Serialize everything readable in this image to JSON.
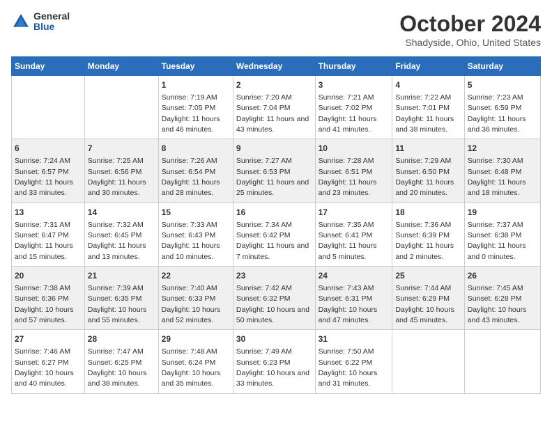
{
  "header": {
    "logo_general": "General",
    "logo_blue": "Blue",
    "main_title": "October 2024",
    "subtitle": "Shadyside, Ohio, United States"
  },
  "columns": [
    "Sunday",
    "Monday",
    "Tuesday",
    "Wednesday",
    "Thursday",
    "Friday",
    "Saturday"
  ],
  "weeks": [
    [
      {
        "day": "",
        "info": ""
      },
      {
        "day": "",
        "info": ""
      },
      {
        "day": "1",
        "info": "Sunrise: 7:19 AM\nSunset: 7:05 PM\nDaylight: 11 hours and 46 minutes."
      },
      {
        "day": "2",
        "info": "Sunrise: 7:20 AM\nSunset: 7:04 PM\nDaylight: 11 hours and 43 minutes."
      },
      {
        "day": "3",
        "info": "Sunrise: 7:21 AM\nSunset: 7:02 PM\nDaylight: 11 hours and 41 minutes."
      },
      {
        "day": "4",
        "info": "Sunrise: 7:22 AM\nSunset: 7:01 PM\nDaylight: 11 hours and 38 minutes."
      },
      {
        "day": "5",
        "info": "Sunrise: 7:23 AM\nSunset: 6:59 PM\nDaylight: 11 hours and 36 minutes."
      }
    ],
    [
      {
        "day": "6",
        "info": "Sunrise: 7:24 AM\nSunset: 6:57 PM\nDaylight: 11 hours and 33 minutes."
      },
      {
        "day": "7",
        "info": "Sunrise: 7:25 AM\nSunset: 6:56 PM\nDaylight: 11 hours and 30 minutes."
      },
      {
        "day": "8",
        "info": "Sunrise: 7:26 AM\nSunset: 6:54 PM\nDaylight: 11 hours and 28 minutes."
      },
      {
        "day": "9",
        "info": "Sunrise: 7:27 AM\nSunset: 6:53 PM\nDaylight: 11 hours and 25 minutes."
      },
      {
        "day": "10",
        "info": "Sunrise: 7:28 AM\nSunset: 6:51 PM\nDaylight: 11 hours and 23 minutes."
      },
      {
        "day": "11",
        "info": "Sunrise: 7:29 AM\nSunset: 6:50 PM\nDaylight: 11 hours and 20 minutes."
      },
      {
        "day": "12",
        "info": "Sunrise: 7:30 AM\nSunset: 6:48 PM\nDaylight: 11 hours and 18 minutes."
      }
    ],
    [
      {
        "day": "13",
        "info": "Sunrise: 7:31 AM\nSunset: 6:47 PM\nDaylight: 11 hours and 15 minutes."
      },
      {
        "day": "14",
        "info": "Sunrise: 7:32 AM\nSunset: 6:45 PM\nDaylight: 11 hours and 13 minutes."
      },
      {
        "day": "15",
        "info": "Sunrise: 7:33 AM\nSunset: 6:43 PM\nDaylight: 11 hours and 10 minutes."
      },
      {
        "day": "16",
        "info": "Sunrise: 7:34 AM\nSunset: 6:42 PM\nDaylight: 11 hours and 7 minutes."
      },
      {
        "day": "17",
        "info": "Sunrise: 7:35 AM\nSunset: 6:41 PM\nDaylight: 11 hours and 5 minutes."
      },
      {
        "day": "18",
        "info": "Sunrise: 7:36 AM\nSunset: 6:39 PM\nDaylight: 11 hours and 2 minutes."
      },
      {
        "day": "19",
        "info": "Sunrise: 7:37 AM\nSunset: 6:38 PM\nDaylight: 11 hours and 0 minutes."
      }
    ],
    [
      {
        "day": "20",
        "info": "Sunrise: 7:38 AM\nSunset: 6:36 PM\nDaylight: 10 hours and 57 minutes."
      },
      {
        "day": "21",
        "info": "Sunrise: 7:39 AM\nSunset: 6:35 PM\nDaylight: 10 hours and 55 minutes."
      },
      {
        "day": "22",
        "info": "Sunrise: 7:40 AM\nSunset: 6:33 PM\nDaylight: 10 hours and 52 minutes."
      },
      {
        "day": "23",
        "info": "Sunrise: 7:42 AM\nSunset: 6:32 PM\nDaylight: 10 hours and 50 minutes."
      },
      {
        "day": "24",
        "info": "Sunrise: 7:43 AM\nSunset: 6:31 PM\nDaylight: 10 hours and 47 minutes."
      },
      {
        "day": "25",
        "info": "Sunrise: 7:44 AM\nSunset: 6:29 PM\nDaylight: 10 hours and 45 minutes."
      },
      {
        "day": "26",
        "info": "Sunrise: 7:45 AM\nSunset: 6:28 PM\nDaylight: 10 hours and 43 minutes."
      }
    ],
    [
      {
        "day": "27",
        "info": "Sunrise: 7:46 AM\nSunset: 6:27 PM\nDaylight: 10 hours and 40 minutes."
      },
      {
        "day": "28",
        "info": "Sunrise: 7:47 AM\nSunset: 6:25 PM\nDaylight: 10 hours and 38 minutes."
      },
      {
        "day": "29",
        "info": "Sunrise: 7:48 AM\nSunset: 6:24 PM\nDaylight: 10 hours and 35 minutes."
      },
      {
        "day": "30",
        "info": "Sunrise: 7:49 AM\nSunset: 6:23 PM\nDaylight: 10 hours and 33 minutes."
      },
      {
        "day": "31",
        "info": "Sunrise: 7:50 AM\nSunset: 6:22 PM\nDaylight: 10 hours and 31 minutes."
      },
      {
        "day": "",
        "info": ""
      },
      {
        "day": "",
        "info": ""
      }
    ]
  ]
}
